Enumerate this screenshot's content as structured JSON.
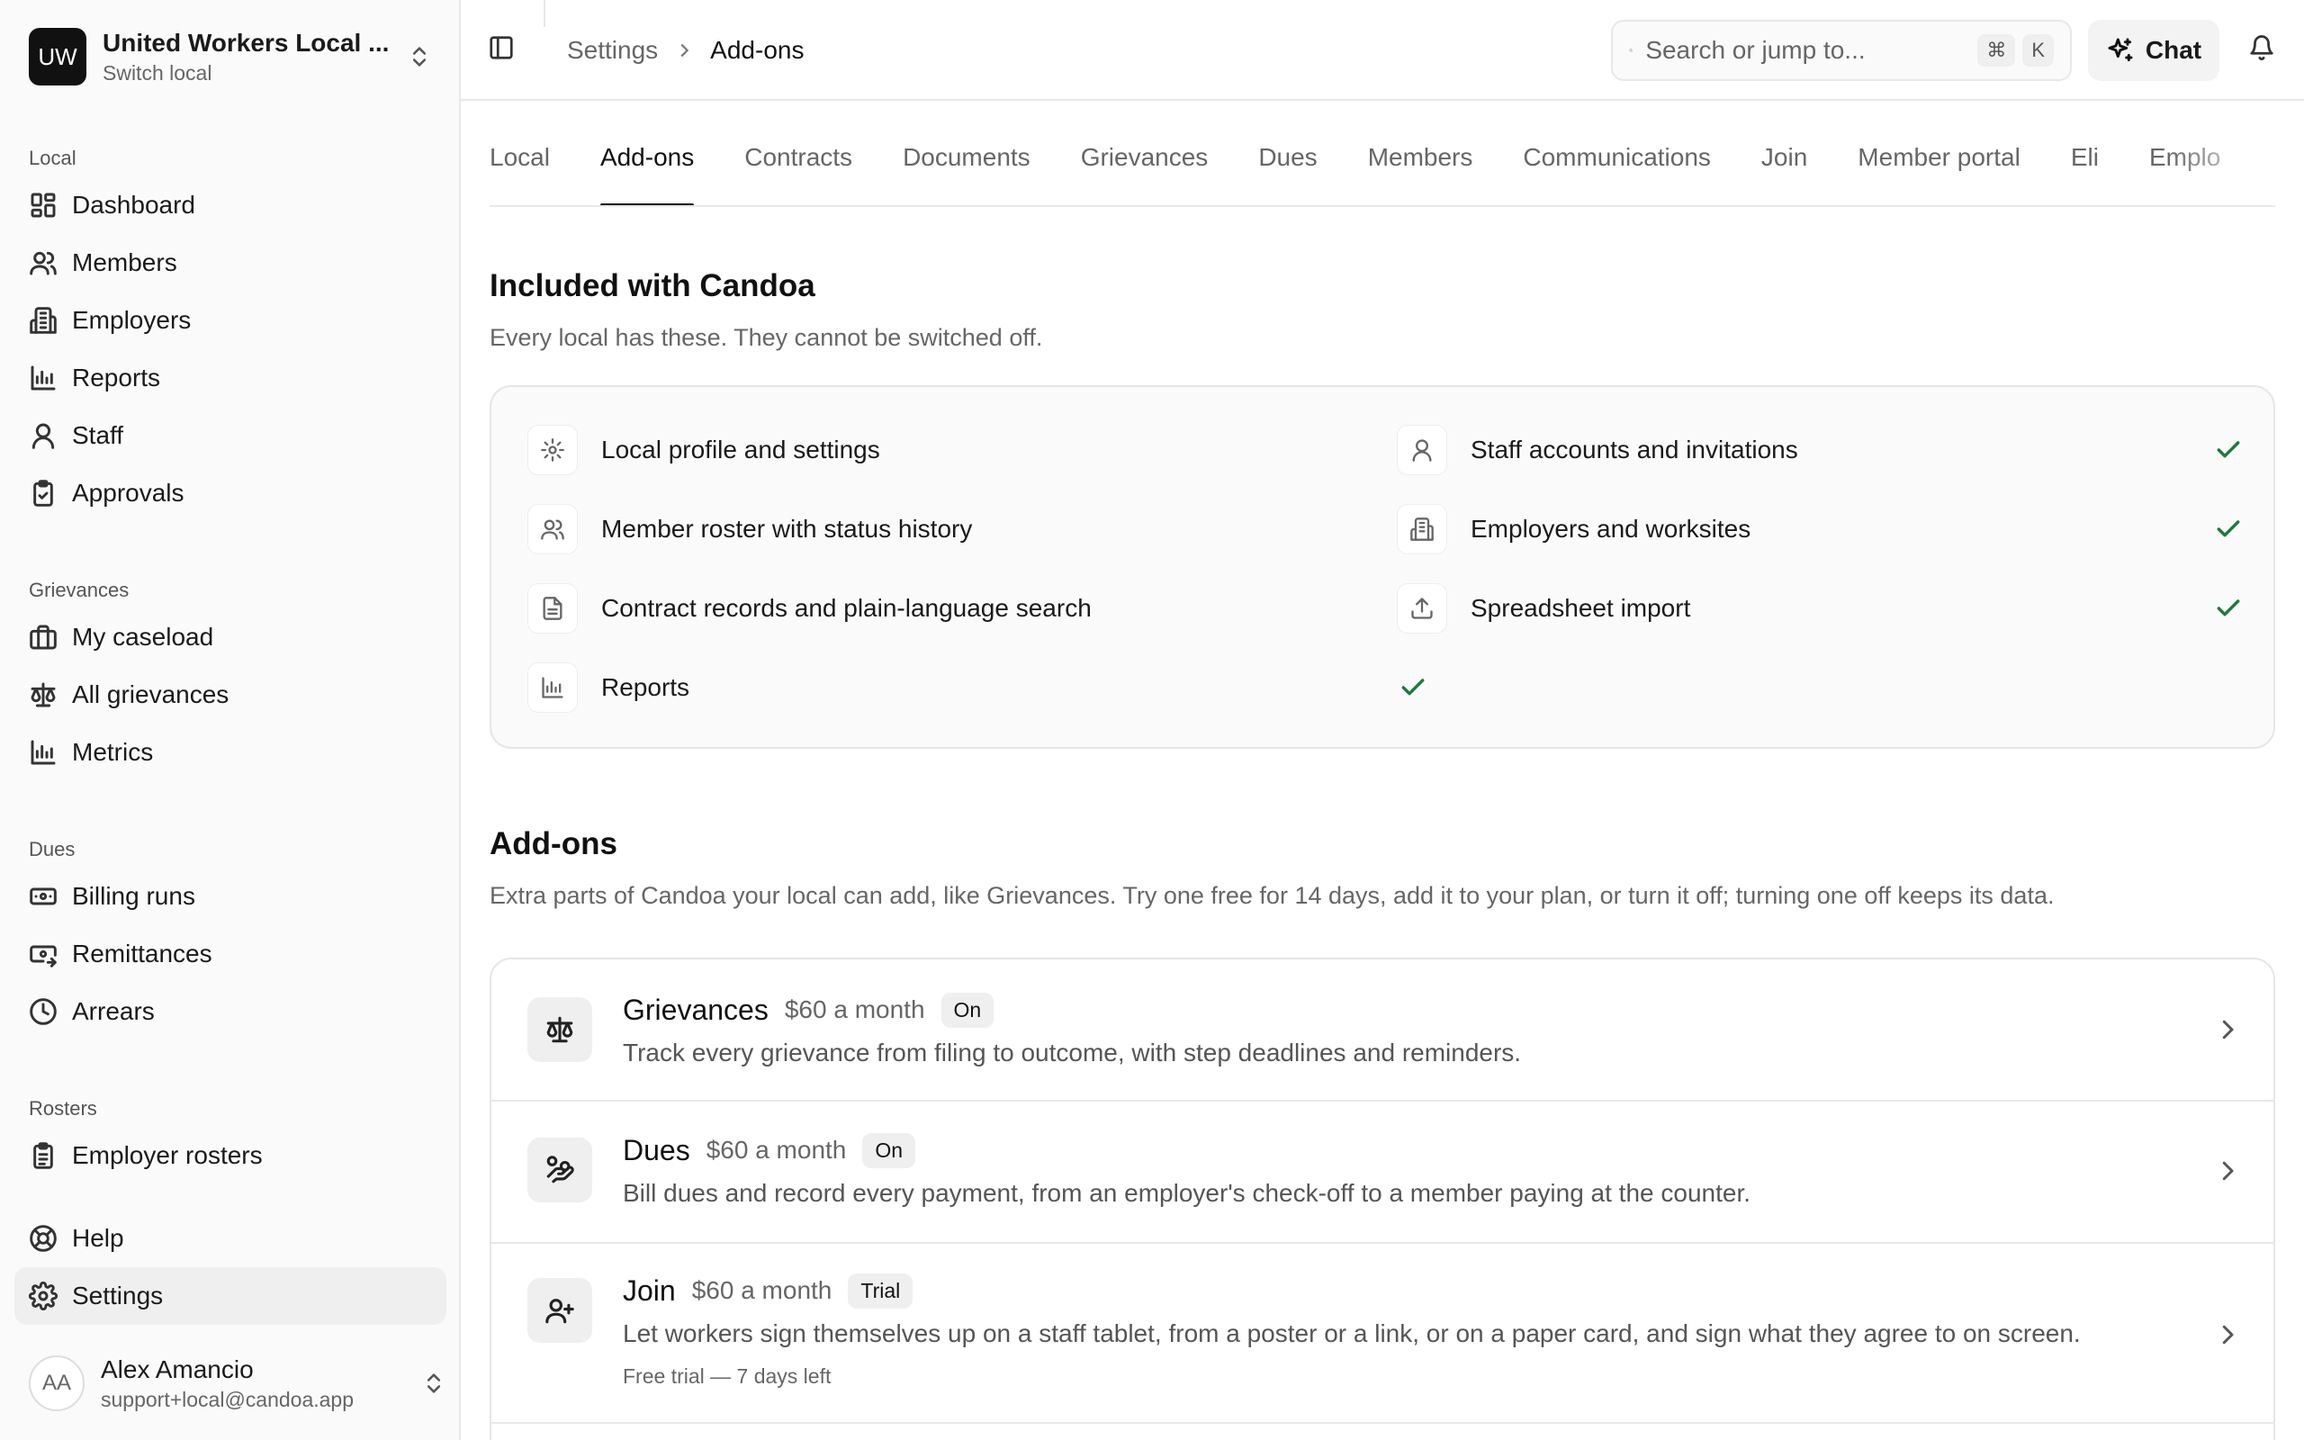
{
  "sidebar": {
    "local": {
      "initials": "UW",
      "name": "United Workers Local ...",
      "sub": "Switch local"
    },
    "sections": [
      {
        "heading": "Local",
        "items": [
          "Dashboard",
          "Members",
          "Employers",
          "Reports",
          "Staff",
          "Approvals"
        ]
      },
      {
        "heading": "Grievances",
        "items": [
          "My caseload",
          "All grievances",
          "Metrics"
        ]
      },
      {
        "heading": "Dues",
        "items": [
          "Billing runs",
          "Remittances",
          "Arrears"
        ]
      },
      {
        "heading": "Rosters",
        "items": [
          "Employer rosters"
        ]
      }
    ],
    "help": "Help",
    "settings": "Settings",
    "user": {
      "initials": "AA",
      "name": "Alex Amancio",
      "email": "support+local@candoa.app"
    }
  },
  "topbar": {
    "breadcrumb": [
      "Settings",
      "Add-ons"
    ],
    "search_placeholder": "Search or jump to...",
    "kbd": [
      "⌘",
      "K"
    ],
    "chat_label": "Chat"
  },
  "tabs": [
    "Local",
    "Add-ons",
    "Contracts",
    "Documents",
    "Grievances",
    "Dues",
    "Members",
    "Communications",
    "Join",
    "Member portal",
    "Eli",
    "Emplo"
  ],
  "active_tab": "Add-ons",
  "included": {
    "title": "Included with Candoa",
    "description": "Every local has these. They cannot be switched off.",
    "items": [
      "Local profile and settings",
      "Staff accounts and invitations",
      "Member roster with status history",
      "Employers and worksites",
      "Contract records and plain-language search",
      "Spreadsheet import",
      "Reports"
    ]
  },
  "addons": {
    "title": "Add-ons",
    "description": "Extra parts of Candoa your local can add, like Grievances. Try one free for 14 days, add it to your plan, or turn it off; turning one off keeps its data.",
    "items": [
      {
        "name": "Grievances",
        "price": "$60 a month",
        "badge": "On",
        "desc": "Track every grievance from filing to outcome, with step deadlines and reminders."
      },
      {
        "name": "Dues",
        "price": "$60 a month",
        "badge": "On",
        "desc": "Bill dues and record every payment, from an employer's check-off to a member paying at the counter."
      },
      {
        "name": "Join",
        "price": "$60 a month",
        "badge": "Trial",
        "desc": "Let workers sign themselves up on a staff tablet, from a poster or a link, or on a paper card, and sign what they agree to on screen.",
        "note": "Free trial — 7 days left"
      }
    ]
  },
  "colors": {
    "check": "#1f7a3d",
    "badge_bg": "#111111",
    "active_bg": "#efefef"
  }
}
